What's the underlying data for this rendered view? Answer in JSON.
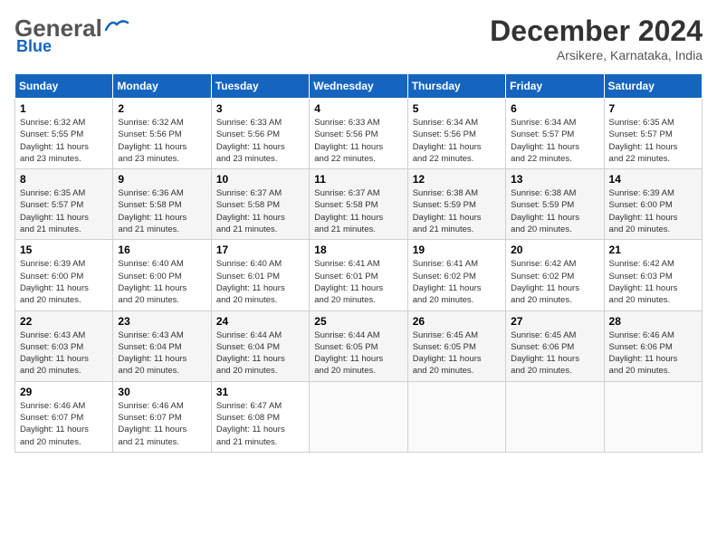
{
  "header": {
    "logo_general": "General",
    "logo_blue": "Blue",
    "month_title": "December 2024",
    "location": "Arsikere, Karnataka, India"
  },
  "weekdays": [
    "Sunday",
    "Monday",
    "Tuesday",
    "Wednesday",
    "Thursday",
    "Friday",
    "Saturday"
  ],
  "weeks": [
    [
      {
        "day": "1",
        "info": "Sunrise: 6:32 AM\nSunset: 5:55 PM\nDaylight: 11 hours\nand 23 minutes."
      },
      {
        "day": "2",
        "info": "Sunrise: 6:32 AM\nSunset: 5:56 PM\nDaylight: 11 hours\nand 23 minutes."
      },
      {
        "day": "3",
        "info": "Sunrise: 6:33 AM\nSunset: 5:56 PM\nDaylight: 11 hours\nand 23 minutes."
      },
      {
        "day": "4",
        "info": "Sunrise: 6:33 AM\nSunset: 5:56 PM\nDaylight: 11 hours\nand 22 minutes."
      },
      {
        "day": "5",
        "info": "Sunrise: 6:34 AM\nSunset: 5:56 PM\nDaylight: 11 hours\nand 22 minutes."
      },
      {
        "day": "6",
        "info": "Sunrise: 6:34 AM\nSunset: 5:57 PM\nDaylight: 11 hours\nand 22 minutes."
      },
      {
        "day": "7",
        "info": "Sunrise: 6:35 AM\nSunset: 5:57 PM\nDaylight: 11 hours\nand 22 minutes."
      }
    ],
    [
      {
        "day": "8",
        "info": "Sunrise: 6:35 AM\nSunset: 5:57 PM\nDaylight: 11 hours\nand 21 minutes."
      },
      {
        "day": "9",
        "info": "Sunrise: 6:36 AM\nSunset: 5:58 PM\nDaylight: 11 hours\nand 21 minutes."
      },
      {
        "day": "10",
        "info": "Sunrise: 6:37 AM\nSunset: 5:58 PM\nDaylight: 11 hours\nand 21 minutes."
      },
      {
        "day": "11",
        "info": "Sunrise: 6:37 AM\nSunset: 5:58 PM\nDaylight: 11 hours\nand 21 minutes."
      },
      {
        "day": "12",
        "info": "Sunrise: 6:38 AM\nSunset: 5:59 PM\nDaylight: 11 hours\nand 21 minutes."
      },
      {
        "day": "13",
        "info": "Sunrise: 6:38 AM\nSunset: 5:59 PM\nDaylight: 11 hours\nand 20 minutes."
      },
      {
        "day": "14",
        "info": "Sunrise: 6:39 AM\nSunset: 6:00 PM\nDaylight: 11 hours\nand 20 minutes."
      }
    ],
    [
      {
        "day": "15",
        "info": "Sunrise: 6:39 AM\nSunset: 6:00 PM\nDaylight: 11 hours\nand 20 minutes."
      },
      {
        "day": "16",
        "info": "Sunrise: 6:40 AM\nSunset: 6:00 PM\nDaylight: 11 hours\nand 20 minutes."
      },
      {
        "day": "17",
        "info": "Sunrise: 6:40 AM\nSunset: 6:01 PM\nDaylight: 11 hours\nand 20 minutes."
      },
      {
        "day": "18",
        "info": "Sunrise: 6:41 AM\nSunset: 6:01 PM\nDaylight: 11 hours\nand 20 minutes."
      },
      {
        "day": "19",
        "info": "Sunrise: 6:41 AM\nSunset: 6:02 PM\nDaylight: 11 hours\nand 20 minutes."
      },
      {
        "day": "20",
        "info": "Sunrise: 6:42 AM\nSunset: 6:02 PM\nDaylight: 11 hours\nand 20 minutes."
      },
      {
        "day": "21",
        "info": "Sunrise: 6:42 AM\nSunset: 6:03 PM\nDaylight: 11 hours\nand 20 minutes."
      }
    ],
    [
      {
        "day": "22",
        "info": "Sunrise: 6:43 AM\nSunset: 6:03 PM\nDaylight: 11 hours\nand 20 minutes."
      },
      {
        "day": "23",
        "info": "Sunrise: 6:43 AM\nSunset: 6:04 PM\nDaylight: 11 hours\nand 20 minutes."
      },
      {
        "day": "24",
        "info": "Sunrise: 6:44 AM\nSunset: 6:04 PM\nDaylight: 11 hours\nand 20 minutes."
      },
      {
        "day": "25",
        "info": "Sunrise: 6:44 AM\nSunset: 6:05 PM\nDaylight: 11 hours\nand 20 minutes."
      },
      {
        "day": "26",
        "info": "Sunrise: 6:45 AM\nSunset: 6:05 PM\nDaylight: 11 hours\nand 20 minutes."
      },
      {
        "day": "27",
        "info": "Sunrise: 6:45 AM\nSunset: 6:06 PM\nDaylight: 11 hours\nand 20 minutes."
      },
      {
        "day": "28",
        "info": "Sunrise: 6:46 AM\nSunset: 6:06 PM\nDaylight: 11 hours\nand 20 minutes."
      }
    ],
    [
      {
        "day": "29",
        "info": "Sunrise: 6:46 AM\nSunset: 6:07 PM\nDaylight: 11 hours\nand 20 minutes."
      },
      {
        "day": "30",
        "info": "Sunrise: 6:46 AM\nSunset: 6:07 PM\nDaylight: 11 hours\nand 21 minutes."
      },
      {
        "day": "31",
        "info": "Sunrise: 6:47 AM\nSunset: 6:08 PM\nDaylight: 11 hours\nand 21 minutes."
      },
      {
        "day": "",
        "info": ""
      },
      {
        "day": "",
        "info": ""
      },
      {
        "day": "",
        "info": ""
      },
      {
        "day": "",
        "info": ""
      }
    ]
  ]
}
